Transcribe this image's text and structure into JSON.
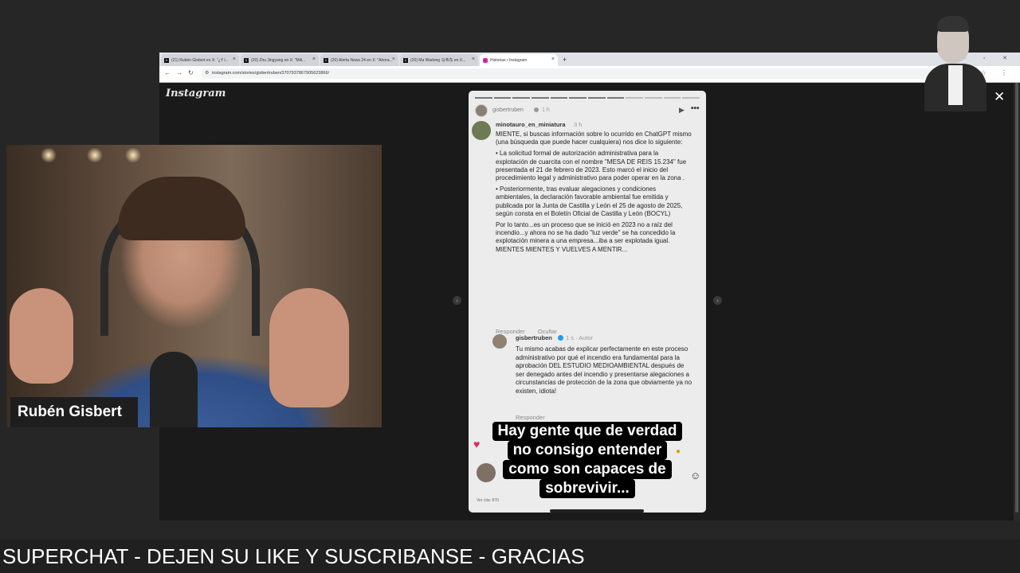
{
  "browser": {
    "tabs": [
      {
        "icon": "X",
        "title": "(21) Rubén Gisbert en X: \"¿Y l..."
      },
      {
        "icon": "X",
        "title": "(20) Zhu Jingyang en X: \"Mili..."
      },
      {
        "icon": "X",
        "title": "(20) Alerta News 24 en X: \"Ahora..."
      },
      {
        "icon": "X",
        "title": "(20) Ma Wadong 马韦东 en X..."
      },
      {
        "icon": "ig",
        "title": "Historias • Instagram",
        "active": true
      }
    ],
    "new_tab": "+",
    "url": "instagram.com/stories/gisbertruben/3707937867905623866/"
  },
  "instagram": {
    "logo": "Instagram",
    "close": "✕",
    "prev": "‹",
    "next": "›",
    "story": {
      "username": "gisbertruben",
      "time": "1 h",
      "comment": {
        "username": "minotauro_en_miniatura",
        "time": "3 h",
        "intro": "MIENTE, si buscas información sobre lo ocurrido en ChatGPT mismo (una búsqueda que puede hacer cualquiera) nos dice lo siguiente:",
        "bullet1": "• La solicitud formal de autorización administrativa para la explotación de cuarcita con el nombre \"MESA DE REIS 15.234\" fue presentada el 21 de febrero de 2023. Esto marcó el inicio del procedimiento legal y administrativo para poder operar en la zona .",
        "bullet2": "• Posteriormente, tras evaluar alegaciones y condiciones ambientales, la declaración favorable ambiental fue emitida y publicada por la Junta de Castilla y León el 25 de agosto de 2025, según consta en el Boletín Oficial de Castilla y León (BOCYL)",
        "conclusion": "Por lo tanto...es un proceso que se inició en 2023 no a raíz del incendio...y ahora no se ha dado \"luz verde\" se ha concedido la explotación minera a una empresa...iba a ser explotada igual. MIENTES MIENTES Y VUELVES A MENTIR...",
        "reply_label": "Responder",
        "hide_label": "Ocultar"
      },
      "reply": {
        "username": "gisbertruben",
        "meta": "1 s · Autor",
        "body": "Tu mismo acabas de explicar perfectamente en este proceso administrativo por qué el incendio era fundamental para la aprobación DEL ESTUDIO MEDIOAMBIENTAL después de ser denegado antes del incendio y presentarse alegaciones a circunstancias de protección de la zona que obviamente ya no existen, idiota!",
        "reply_label": "Responder"
      },
      "overlay_lines": [
        "Hay gente que de verdad",
        "no consigo entender",
        "como son capaces de",
        "sobrevivir..."
      ],
      "footer_label": "Ver cita: 870"
    }
  },
  "webcam": {
    "name": "Rubén Gisbert"
  },
  "ticker": {
    "text": "SUPERCHAT - DEJEN SU LIKE Y SUSCRIBANSE - GRACIAS"
  }
}
